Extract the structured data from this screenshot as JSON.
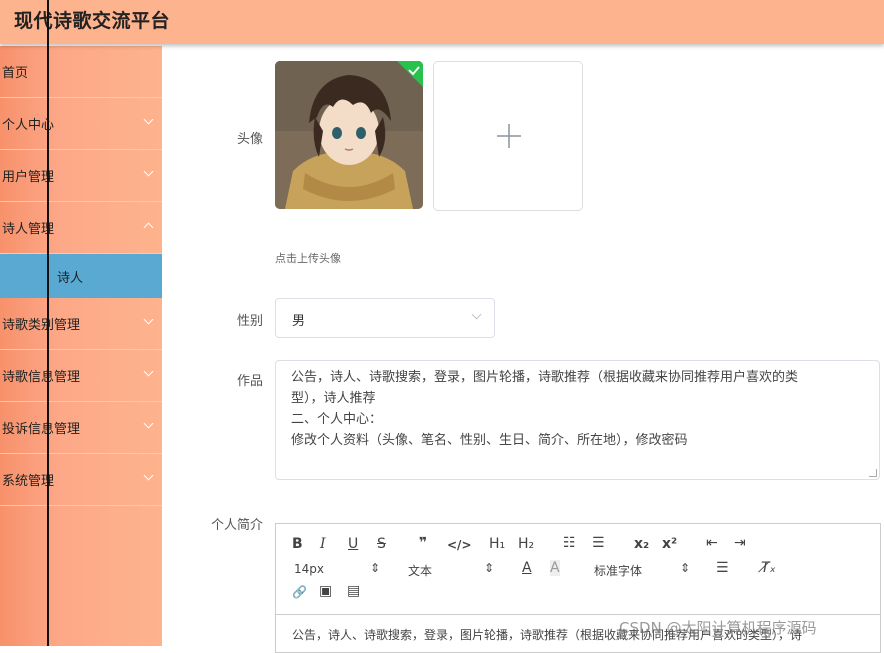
{
  "header": {
    "title": "现代诗歌交流平台"
  },
  "sidebar": {
    "items": [
      {
        "label": "首页"
      },
      {
        "label": "个人中心"
      },
      {
        "label": "用户管理"
      },
      {
        "label": "诗人管理"
      },
      {
        "label": "诗歌类别管理"
      },
      {
        "label": "诗歌信息管理"
      },
      {
        "label": "投诉信息管理"
      },
      {
        "label": "系统管理"
      }
    ],
    "active_sub": {
      "label": "诗人"
    }
  },
  "form": {
    "avatar": {
      "label": "头像",
      "hint": "点击上传头像"
    },
    "gender": {
      "label": "性别",
      "value": "男"
    },
    "works": {
      "label": "作品",
      "lines": [
        "公告，诗人、诗歌搜索，登录，图片轮播，诗歌推荐（根据收藏来协同推荐用户喜欢的类",
        "型），诗人推荐",
        "二、个人中心：",
        "修改个人资料（头像、笔名、性别、生日、简介、所在地），修改密码"
      ]
    },
    "intro": {
      "label": "个人简介",
      "toolbar": {
        "bold": "B",
        "italic": "I",
        "underline": "U",
        "strike": "S",
        "quote": "❞",
        "code": "</>",
        "h1": "H₁",
        "h2": "H₂",
        "ol": "☷",
        "ul": "☰",
        "sub": "x₂",
        "sup": "x²",
        "outdent": "⇤",
        "indent": "⇥",
        "size": "14px",
        "header": "文本",
        "font": "标准字体",
        "color": "A",
        "background": "A",
        "align": "☰",
        "clean": "T̸ₓ",
        "link": "🔗",
        "image": "▣",
        "video": "▤"
      },
      "content": "公告，诗人、诗歌搜索，登录，图片轮播，诗歌推荐（根据收藏来协同推荐用户喜欢的类型），诗"
    }
  },
  "watermark": "CSDN @太阳计算机程序源码"
}
